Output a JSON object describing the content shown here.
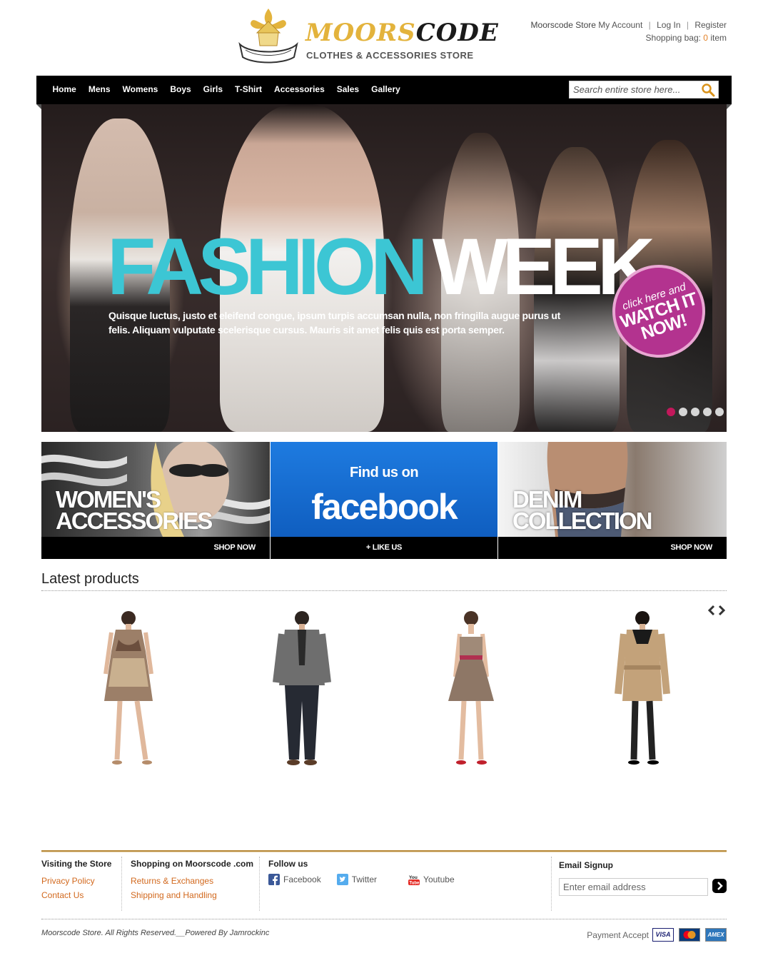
{
  "header": {
    "logo": {
      "name_part1": "MOORS",
      "name_part2": "CODE",
      "tagline": "CLOTHES & ACCESSORIES STORE"
    },
    "account": {
      "store_name": "Moorscode Store",
      "my_account": "My Account",
      "log_in": "Log In",
      "register": "Register",
      "bag_label": "Shopping bag:",
      "bag_count": "0",
      "bag_unit": "item"
    }
  },
  "nav": {
    "items": [
      "Home",
      "Mens",
      "Womens",
      "Boys",
      "Girls",
      "T-Shirt",
      "Accessories",
      "Sales",
      "Gallery"
    ],
    "search_placeholder": "Search entire store here..."
  },
  "hero": {
    "title_1": "FASHION",
    "title_2": "WEEK",
    "text": "Quisque luctus, justo et eleifend congue, ipsum turpis accumsan nulla, non fringilla augue purus ut felis. Aliquam vulputate scelerisque cursus. Mauris sit amet felis quis est porta semper.",
    "badge_line1": "click here and",
    "badge_line2": "WATCH IT NOW!",
    "slide_count": 5,
    "active_slide": 1,
    "accent_color": "#3cc6d4",
    "badge_color": "#b3338f"
  },
  "banners": [
    {
      "heading": "WOMEN'S\nACCESSORIES",
      "cta": "SHOP NOW"
    },
    {
      "find_text": "Find us on",
      "brand": "facebook",
      "cta": "+ LIKE US"
    },
    {
      "heading": "DENIM\nCOLLECTION",
      "cta": "SHOP NOW"
    }
  ],
  "latest": {
    "title": "Latest products",
    "products": [
      {
        "icon": "floral-dress-product"
      },
      {
        "icon": "mens-blazer-product"
      },
      {
        "icon": "strapless-dress-product"
      },
      {
        "icon": "trench-coat-product"
      }
    ]
  },
  "footer": {
    "col1": {
      "title": "Visiting the Store",
      "links": [
        "Privacy Policy",
        "Contact Us"
      ]
    },
    "col2": {
      "title": "Shopping on Moorscode .com",
      "links": [
        "Returns & Exchanges",
        "Shipping and Handling"
      ]
    },
    "col3": {
      "title": "Follow us",
      "links": [
        "Facebook",
        "Twitter",
        "Youtube"
      ]
    },
    "col4": {
      "title": "Email Signup",
      "placeholder": "Enter email address"
    },
    "copyright": "Moorscode Store. All Rights Reserved.__Powered By Jamrockinc",
    "payment_label": "Payment Accept",
    "cards": [
      "VISA",
      "MasterCard",
      "AMEX"
    ],
    "link_color": "#d2691e",
    "rule_color": "#b88a3a"
  }
}
